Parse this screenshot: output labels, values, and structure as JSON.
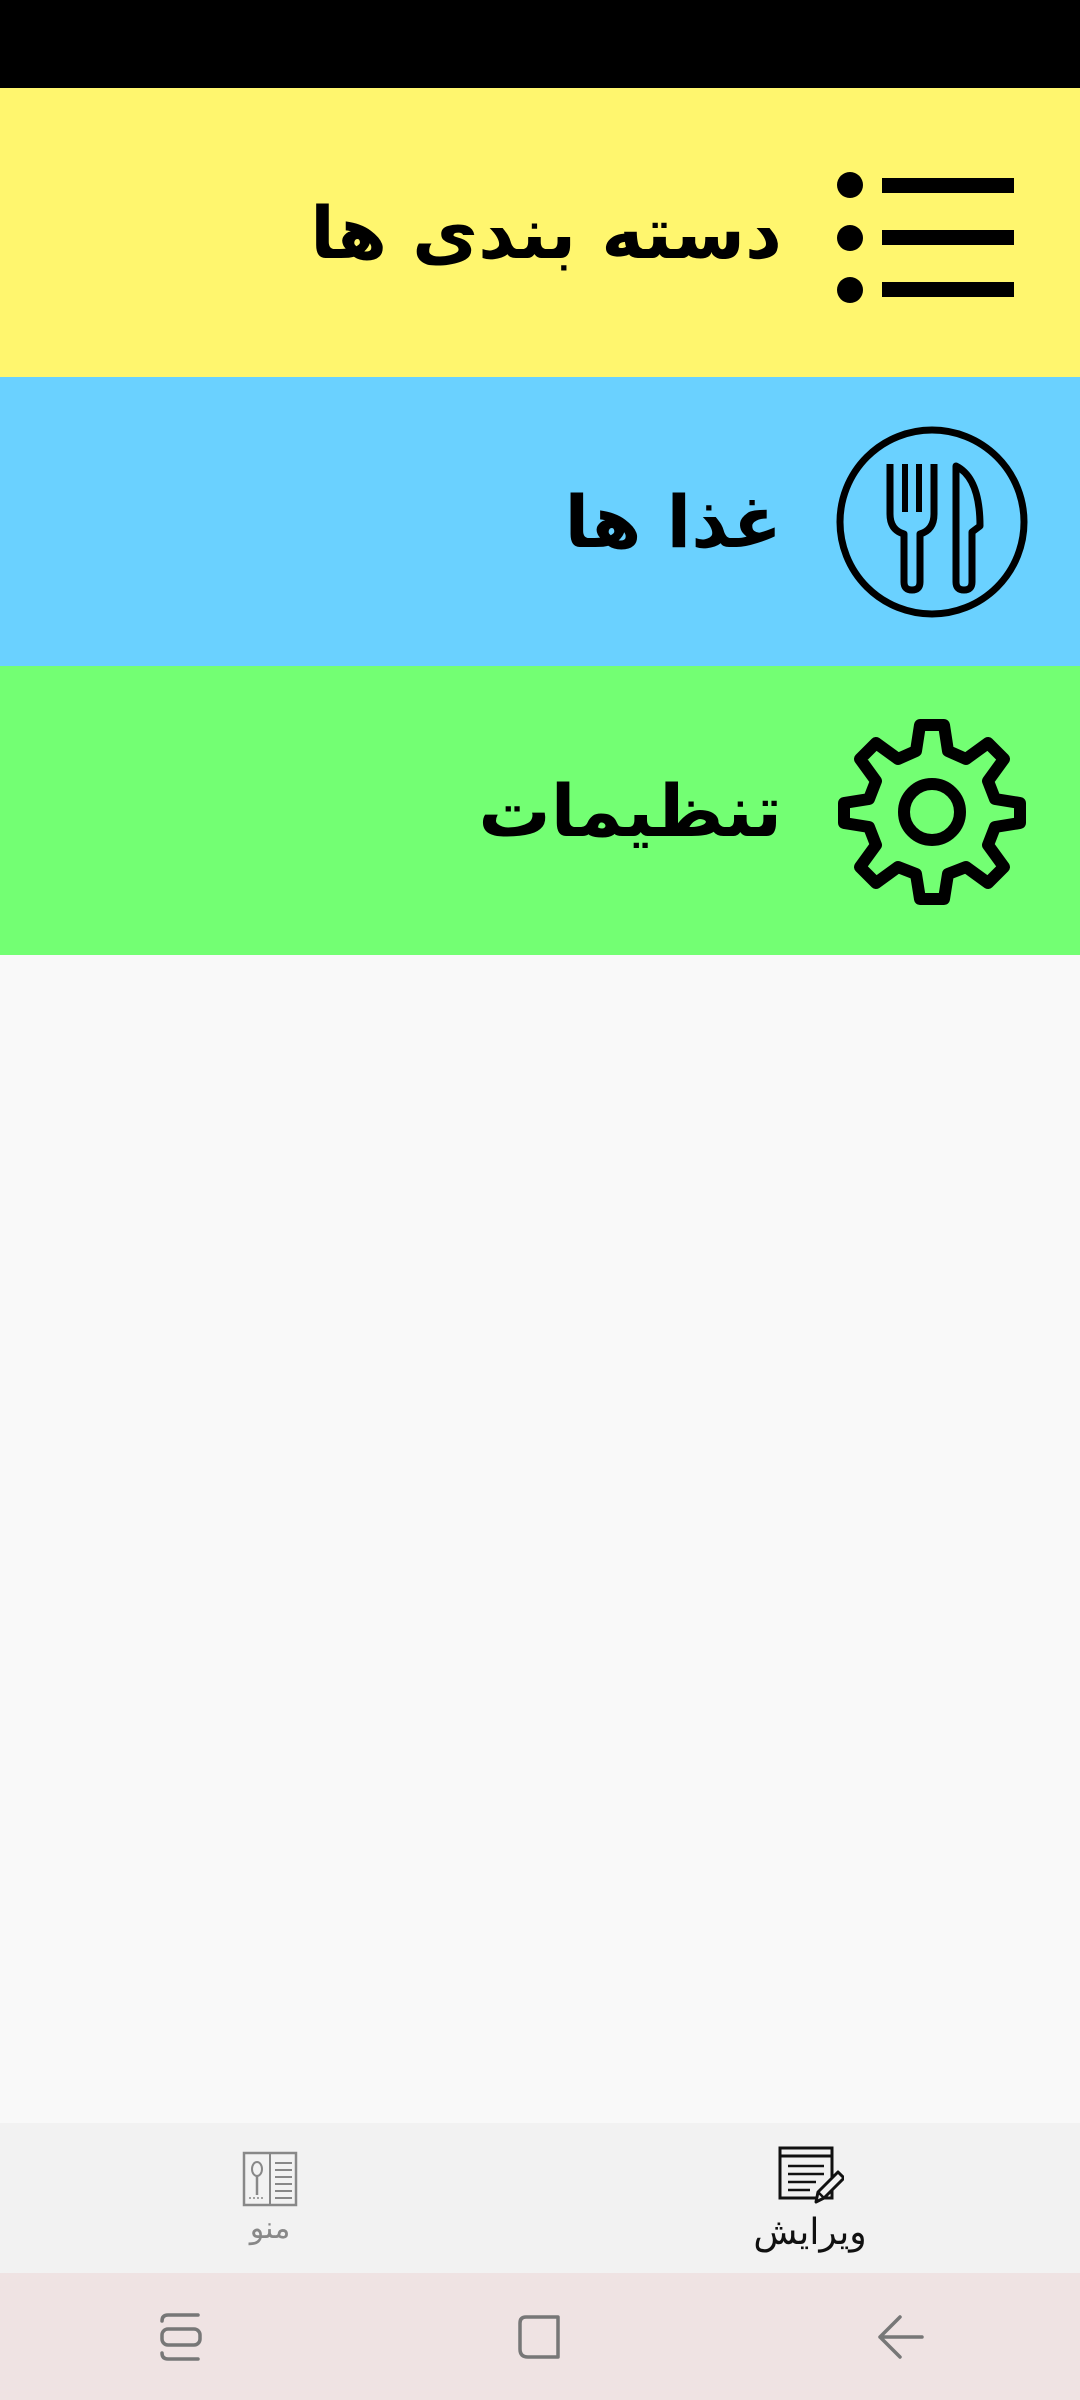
{
  "colors": {
    "status_bar": "#000000",
    "categories_bg": "#fff66e",
    "foods_bg": "#6ad1ff",
    "settings_bg": "#73ff73",
    "content_bg": "#f9f9f9",
    "bottom_nav_bg": "#f2f2f2",
    "system_nav_bg": "#efe3e3"
  },
  "menu": {
    "items": [
      {
        "label": "دسته بندی ها",
        "icon": "list-icon"
      },
      {
        "label": "غذا ها",
        "icon": "fork-knife-icon"
      },
      {
        "label": "تنظیمات",
        "icon": "gear-icon"
      }
    ]
  },
  "bottom_nav": {
    "tabs": [
      {
        "label": "منو",
        "icon": "menu-book-icon",
        "active": false
      },
      {
        "label": "ویرایش",
        "icon": "edit-document-icon",
        "active": true
      }
    ]
  },
  "system_nav": {
    "buttons": [
      {
        "icon": "recent-apps-icon"
      },
      {
        "icon": "home-icon"
      },
      {
        "icon": "back-icon"
      }
    ]
  }
}
